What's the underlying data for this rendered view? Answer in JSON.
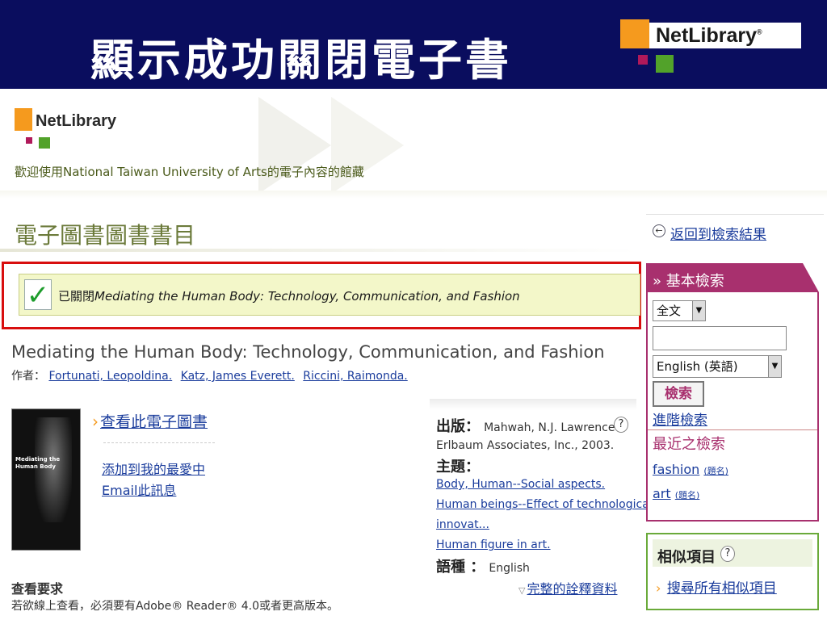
{
  "slide": {
    "title": "顯示成功關閉電子書",
    "logo_text": "NetLibrary",
    "logo_reg": "®"
  },
  "site": {
    "logo_text": "NetLibrary",
    "welcome": "歡迎使用National Taiwan University of Arts的電子內容的館藏"
  },
  "catalog": {
    "title": "電子圖書圖書書目"
  },
  "notice": {
    "check_glyph": "✓",
    "closed_prefix": "已關閉",
    "closed_book": "Mediating the Human Body: Technology, Communication, and Fashion"
  },
  "book": {
    "title": "Mediating the Human Body: Technology, Communication, and Fashion",
    "authors_label": "作者：",
    "authors": [
      "Fortunati, Leopoldina.",
      "Katz, James Everett.",
      "Riccini, Raimonda."
    ],
    "cover_title": "Mediating the Human Body"
  },
  "actions": {
    "view_ebook": "查看此電子圖書",
    "add_favorite": "添加到我的最愛中",
    "email_message": "Email此訊息"
  },
  "requirements": {
    "title": "查看要求",
    "text": "若欲線上查看，必須要有Adobe® Reader® 4.0或者更高版本。"
  },
  "details": {
    "publisher_label": "出版：",
    "publisher_line1": "Mahwah, N.J. Lawrence",
    "publisher_line2": "Erlbaum Associates, Inc., 2003.",
    "subject_label": "主題：",
    "subjects": [
      "Body, Human--Social aspects.",
      "Human beings--Effect of technological",
      "innovat...",
      "Human figure in art."
    ],
    "language_label": "語種 ：",
    "language_value": "English",
    "full_record": "完整的詮釋資料",
    "help_glyph": "?"
  },
  "sidebar": {
    "back_to_results": "返回到檢索結果",
    "back_glyph": "←",
    "basic_search_title": "» 基本檢索",
    "field_select": "全文",
    "search_input_value": "",
    "language_select": "English (英語)",
    "search_button": "檢索",
    "advanced_search": "進階檢索",
    "recent_title": "最近之檢索",
    "recent": [
      {
        "term": "fashion",
        "tag": "(題名)"
      },
      {
        "term": "art",
        "tag": "(題名)"
      }
    ],
    "similar_title": "相似項目",
    "similar_link": "搜尋所有相似項目",
    "arrow_glyph": "›",
    "dropdown_glyph": "▼"
  },
  "colors": {
    "slide_bg": "#0a0d5e",
    "accent_magenta": "#a8306e",
    "accent_green": "#6aaa3a",
    "link_blue": "#1a3c9c",
    "highlight_red": "#d80e0e",
    "notice_bg": "#f3f7c9"
  }
}
